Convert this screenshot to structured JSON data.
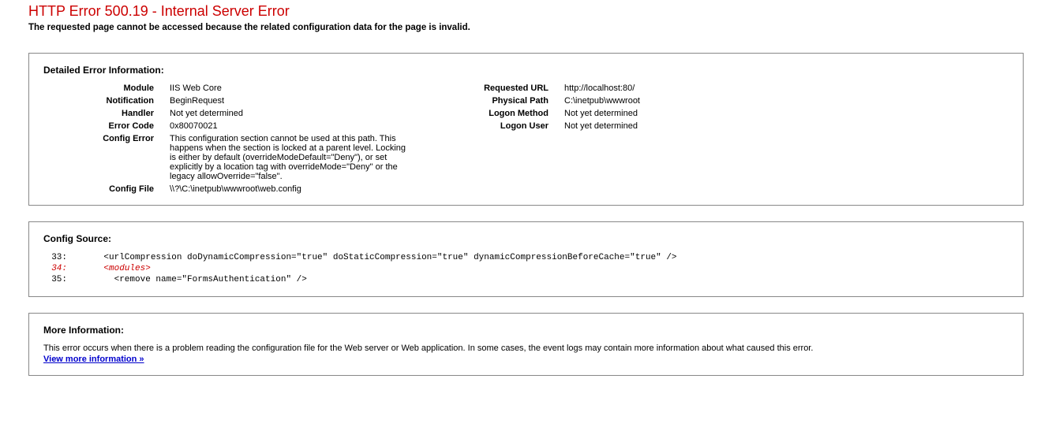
{
  "header": {
    "title": "HTTP Error 500.19 - Internal Server Error",
    "subtitle": "The requested page cannot be accessed because the related configuration data for the page is invalid."
  },
  "detail_section": {
    "heading": "Detailed Error Information:",
    "left": {
      "module_label": "Module",
      "module_value": "IIS Web Core",
      "notification_label": "Notification",
      "notification_value": "BeginRequest",
      "handler_label": "Handler",
      "handler_value": "Not yet determined",
      "error_code_label": "Error Code",
      "error_code_value": "0x80070021",
      "config_error_label": "Config Error",
      "config_error_value": "This configuration section cannot be used at this path. This happens when the section is locked at a parent level. Locking is either by default (overrideModeDefault=\"Deny\"), or set explicitly by a location tag with overrideMode=\"Deny\" or the legacy allowOverride=\"false\".",
      "config_file_label": "Config File",
      "config_file_value": "\\\\?\\C:\\inetpub\\wwwroot\\web.config"
    },
    "right": {
      "requested_url_label": "Requested URL",
      "requested_url_value": "http://localhost:80/",
      "physical_path_label": "Physical Path",
      "physical_path_value": "C:\\inetpub\\wwwroot",
      "logon_method_label": "Logon Method",
      "logon_method_value": "Not yet determined",
      "logon_user_label": "Logon User",
      "logon_user_value": "Not yet determined"
    }
  },
  "config_source": {
    "heading": "Config Source:",
    "lines": {
      "l33_num": "33:",
      "l33_code": "    <urlCompression doDynamicCompression=\"true\" doStaticCompression=\"true\" dynamicCompressionBeforeCache=\"true\" />",
      "l34_num": "34:",
      "l34_code": "    <modules>",
      "l35_num": "35:",
      "l35_code": "      <remove name=\"FormsAuthentication\" />"
    }
  },
  "more_info": {
    "heading": "More Information:",
    "body": "This error occurs when there is a problem reading the configuration file for the Web server or Web application. In some cases, the event logs may contain more information about what caused this error.",
    "link_text": "View more information »"
  }
}
